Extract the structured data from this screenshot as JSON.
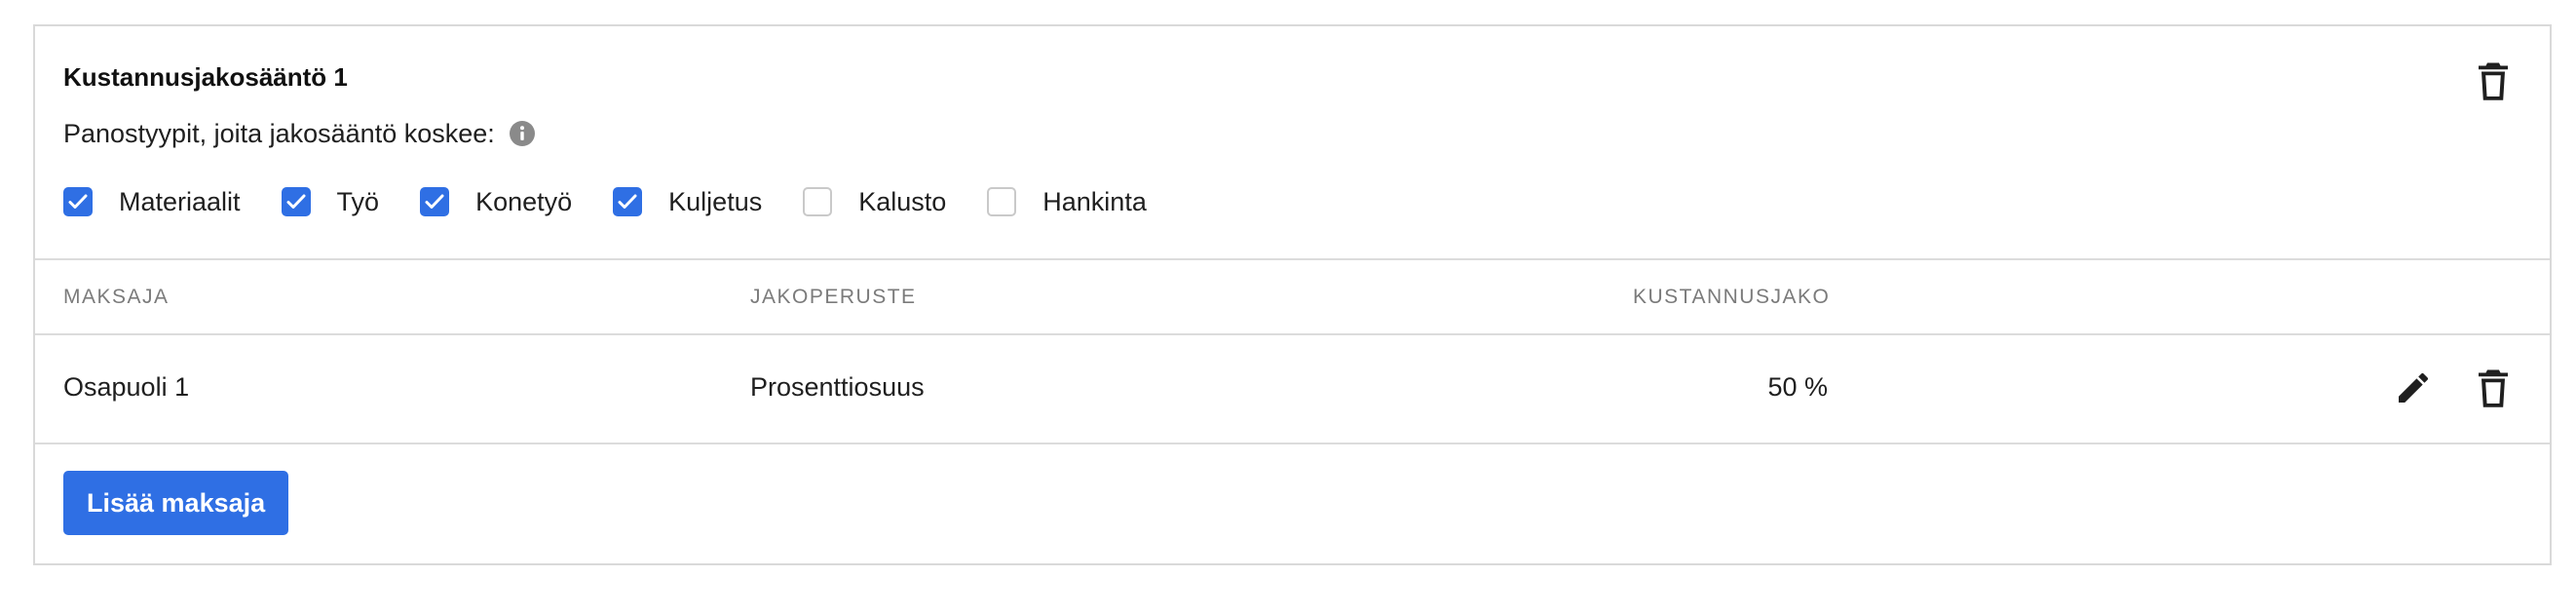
{
  "rule": {
    "title": "Kustannusjakosääntö 1",
    "applies_label": "Panostyypit, joita jakosääntö koskee:",
    "cost_types": [
      {
        "label": "Materiaalit",
        "checked": true
      },
      {
        "label": "Työ",
        "checked": true
      },
      {
        "label": "Konetyö",
        "checked": true
      },
      {
        "label": "Kuljetus",
        "checked": true
      },
      {
        "label": "Kalusto",
        "checked": false
      },
      {
        "label": "Hankinta",
        "checked": false
      }
    ]
  },
  "table": {
    "headers": {
      "payer": "MAKSAJA",
      "basis": "JAKOPERUSTE",
      "share": "KUSTANNUSJAKO"
    },
    "rows": [
      {
        "payer": "Osapuoli 1",
        "basis": "Prosenttiosuus",
        "share": "50 %"
      }
    ]
  },
  "actions": {
    "add_payer_label": "Lisää maksaja"
  },
  "icons": {
    "delete": "trash-icon",
    "edit": "pencil-icon",
    "info": "info-icon",
    "check": "check-icon"
  },
  "colors": {
    "accent": "#2f6fe4",
    "border": "#d9d9d9",
    "muted_text": "#7b7b7b"
  }
}
